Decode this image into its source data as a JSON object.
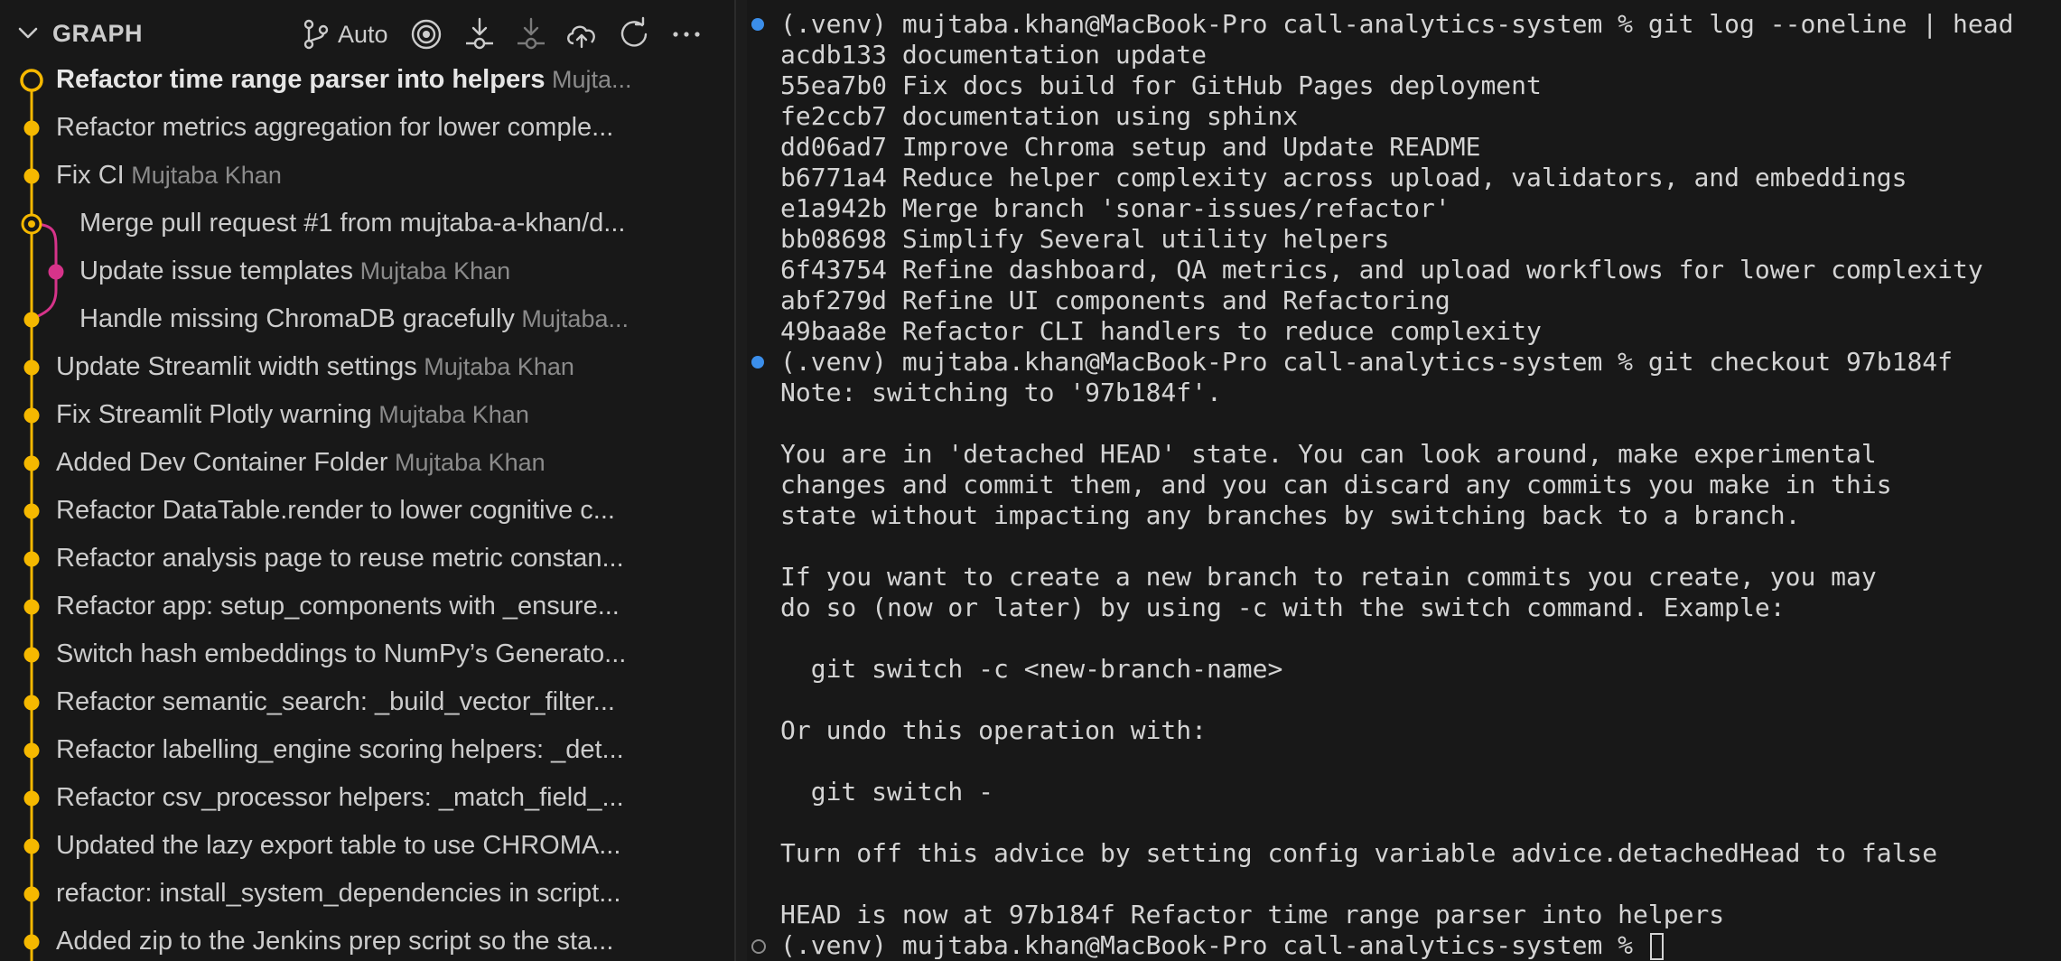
{
  "graph_panel": {
    "title": "GRAPH",
    "auto_label": "Auto",
    "icons": [
      "chevron-down-icon",
      "branch-auto-icon",
      "target-icon",
      "fetch-icon",
      "pull-icon",
      "push-icon",
      "refresh-icon",
      "more-icon"
    ],
    "colors": {
      "main_line": "#f5b800",
      "branch_line": "#d6338a"
    },
    "commits": [
      {
        "subject": "Refactor time range parser into helpers",
        "author": "Mujta..."
      },
      {
        "subject": "Refactor metrics aggregation for lower comple...",
        "author": ""
      },
      {
        "subject": "Fix CI",
        "author": "Mujtaba Khan"
      },
      {
        "subject": "Merge pull request #1 from mujtaba-a-khan/d...",
        "author": ""
      },
      {
        "subject": "Update issue templates",
        "author": "Mujtaba Khan"
      },
      {
        "subject": "Handle missing ChromaDB gracefully",
        "author": "Mujtaba..."
      },
      {
        "subject": "Update Streamlit width settings",
        "author": "Mujtaba Khan"
      },
      {
        "subject": "Fix Streamlit Plotly warning",
        "author": "Mujtaba Khan"
      },
      {
        "subject": "Added Dev Container Folder",
        "author": "Mujtaba Khan"
      },
      {
        "subject": "Refactor DataTable.render to lower cognitive c...",
        "author": ""
      },
      {
        "subject": "Refactor analysis page to reuse metric constan...",
        "author": ""
      },
      {
        "subject": "Refactor app: setup_components with _ensure...",
        "author": ""
      },
      {
        "subject": "Switch hash embeddings to NumPy’s Generato...",
        "author": ""
      },
      {
        "subject": "Refactor semantic_search: _build_vector_filter...",
        "author": ""
      },
      {
        "subject": "Refactor labelling_engine scoring helpers: _det...",
        "author": ""
      },
      {
        "subject": "Refactor csv_processor helpers: _match_field_...",
        "author": ""
      },
      {
        "subject": "Updated the lazy export table to use CHROMA...",
        "author": ""
      },
      {
        "subject": "refactor: install_system_dependencies in script...",
        "author": ""
      },
      {
        "subject": "Added zip to the Jenkins prep script so the sta...",
        "author": ""
      }
    ]
  },
  "terminal": {
    "lines": [
      {
        "dot": "ok",
        "text": "(.venv) mujtaba.khan@MacBook-Pro call-analytics-system % git log --oneline | head"
      },
      {
        "dot": "",
        "text": "acdb133 documentation update"
      },
      {
        "dot": "",
        "text": "55ea7b0 Fix docs build for GitHub Pages deployment"
      },
      {
        "dot": "",
        "text": "fe2ccb7 documentation using sphinx"
      },
      {
        "dot": "",
        "text": "dd06ad7 Improve Chroma setup and Update README"
      },
      {
        "dot": "",
        "text": "b6771a4 Reduce helper complexity across upload, validators, and embeddings"
      },
      {
        "dot": "",
        "text": "e1a942b Merge branch 'sonar-issues/refactor'"
      },
      {
        "dot": "",
        "text": "bb08698 Simplify Several utility helpers"
      },
      {
        "dot": "",
        "text": "6f43754 Refine dashboard, QA metrics, and upload workflows for lower complexity"
      },
      {
        "dot": "",
        "text": "abf279d Refine UI components and Refactoring"
      },
      {
        "dot": "",
        "text": "49baa8e Refactor CLI handlers to reduce complexity"
      },
      {
        "dot": "ok",
        "text": "(.venv) mujtaba.khan@MacBook-Pro call-analytics-system % git checkout 97b184f"
      },
      {
        "dot": "",
        "text": "Note: switching to '97b184f'."
      },
      {
        "dot": "",
        "text": ""
      },
      {
        "dot": "",
        "text": "You are in 'detached HEAD' state. You can look around, make experimental"
      },
      {
        "dot": "",
        "text": "changes and commit them, and you can discard any commits you make in this"
      },
      {
        "dot": "",
        "text": "state without impacting any branches by switching back to a branch."
      },
      {
        "dot": "",
        "text": ""
      },
      {
        "dot": "",
        "text": "If you want to create a new branch to retain commits you create, you may"
      },
      {
        "dot": "",
        "text": "do so (now or later) by using -c with the switch command. Example:"
      },
      {
        "dot": "",
        "text": ""
      },
      {
        "dot": "",
        "text": "  git switch -c <new-branch-name>"
      },
      {
        "dot": "",
        "text": ""
      },
      {
        "dot": "",
        "text": "Or undo this operation with:"
      },
      {
        "dot": "",
        "text": ""
      },
      {
        "dot": "",
        "text": "  git switch -"
      },
      {
        "dot": "",
        "text": ""
      },
      {
        "dot": "",
        "text": "Turn off this advice by setting config variable advice.detachedHead to false"
      },
      {
        "dot": "",
        "text": ""
      },
      {
        "dot": "",
        "text": "HEAD is now at 97b184f Refactor time range parser into helpers"
      },
      {
        "dot": "pending",
        "text": "(.venv) mujtaba.khan@MacBook-Pro call-analytics-system % ",
        "cursor": true
      }
    ]
  }
}
